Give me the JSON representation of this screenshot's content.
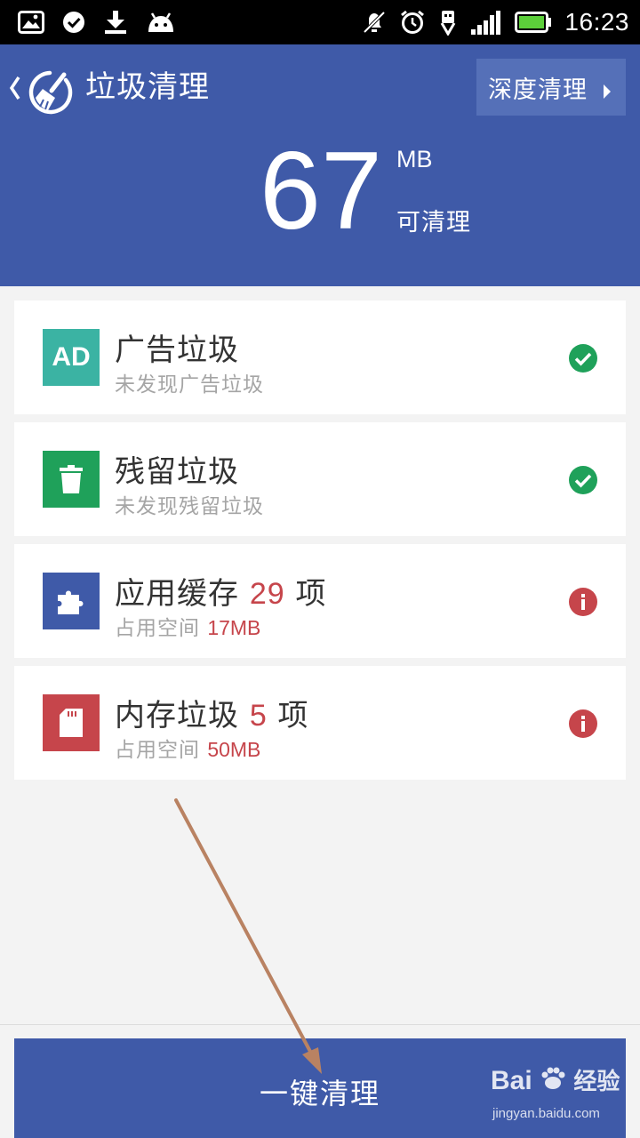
{
  "status_bar": {
    "time": "16:23",
    "left_icons": [
      "image-icon",
      "check-circle-icon",
      "download-icon",
      "android-icon"
    ],
    "right_icons": [
      "mute-icon",
      "alarm-icon",
      "usb-icon",
      "signal-icon",
      "battery-icon"
    ]
  },
  "header": {
    "title": "垃圾清理",
    "deep_clean_label": "深度清理",
    "amount": "67",
    "unit": "MB",
    "amount_caption": "可清理",
    "background_color": "#3f5aa8"
  },
  "items": [
    {
      "title": "广告垃圾",
      "subtitle": "未发现广告垃圾",
      "icon_text": "AD",
      "icon": "ad-icon",
      "icon_color": "#3bb3a3",
      "status": "ok"
    },
    {
      "title": "残留垃圾",
      "subtitle": "未发现残留垃圾",
      "icon": "trash-icon",
      "icon_color": "#1fa15a",
      "status": "ok"
    },
    {
      "title": "应用缓存",
      "count": "29",
      "count_unit": "项",
      "subtitle": "占用空间",
      "size": "17MB",
      "icon": "puzzle-icon",
      "icon_color": "#3f5aa8",
      "status": "warning"
    },
    {
      "title": "内存垃圾",
      "count": "5",
      "count_unit": "项",
      "subtitle": "占用空间",
      "size": "50MB",
      "icon": "memory-card-icon",
      "icon_color": "#c6454b",
      "status": "warning"
    }
  ],
  "colors": {
    "ok": "#1fa15a",
    "warning": "#c6454b",
    "highlight": "#c6454b"
  },
  "clean_button_label": "一键清理",
  "watermark": {
    "brand": "Bai",
    "brand_suffix": "经验",
    "url": "jingyan.baidu.com"
  }
}
